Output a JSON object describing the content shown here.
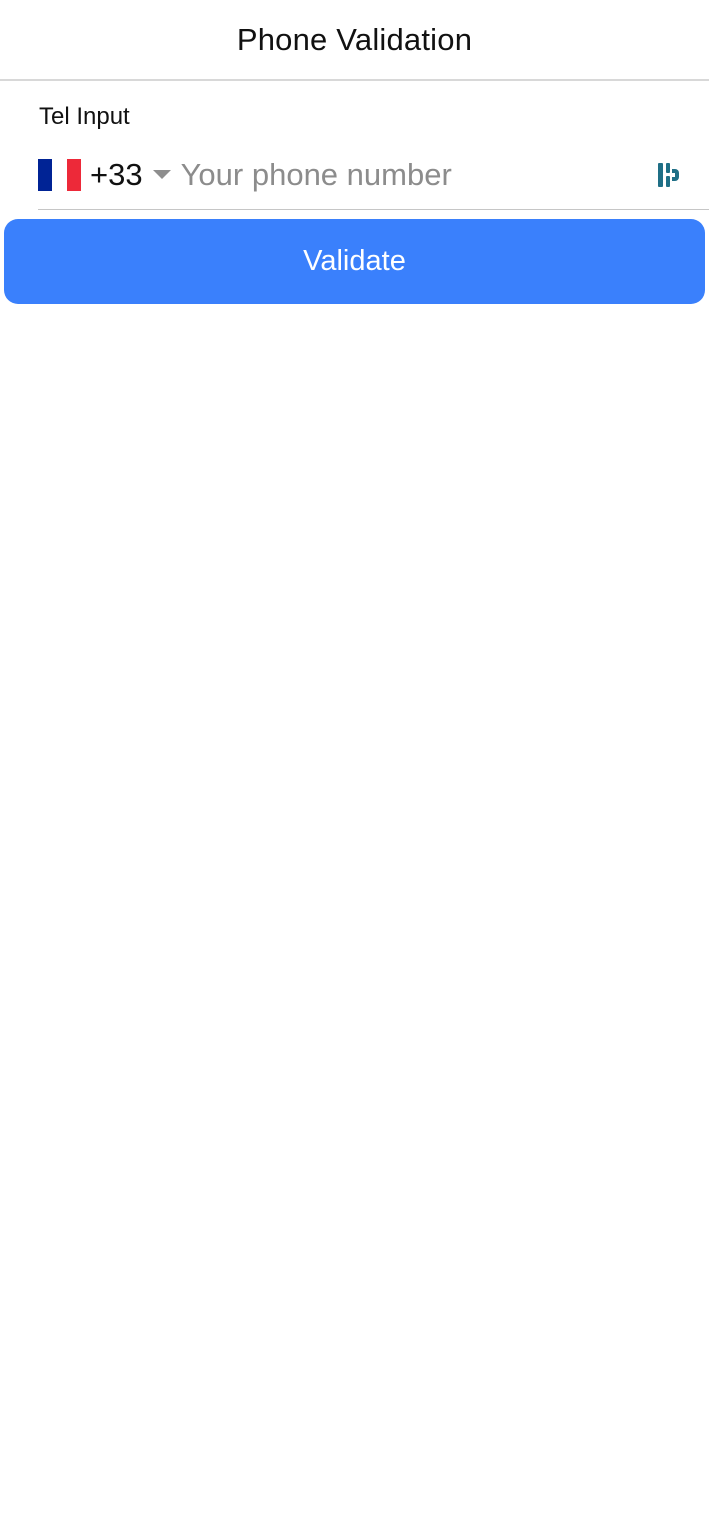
{
  "nav": {
    "title": "Phone Validation"
  },
  "form": {
    "label": "Tel Input",
    "country": {
      "flag_icon": "france-flag-icon",
      "flag_colors": [
        "#002395",
        "#ffffff",
        "#ed2939"
      ],
      "dial_code": "+33",
      "dropdown_icon": "chevron-down-icon"
    },
    "phone": {
      "value": "",
      "placeholder": "Your phone number"
    },
    "autofill_icon": "password-manager-icon"
  },
  "actions": {
    "validate_label": "Validate",
    "validate_color": "#3a80fc"
  }
}
